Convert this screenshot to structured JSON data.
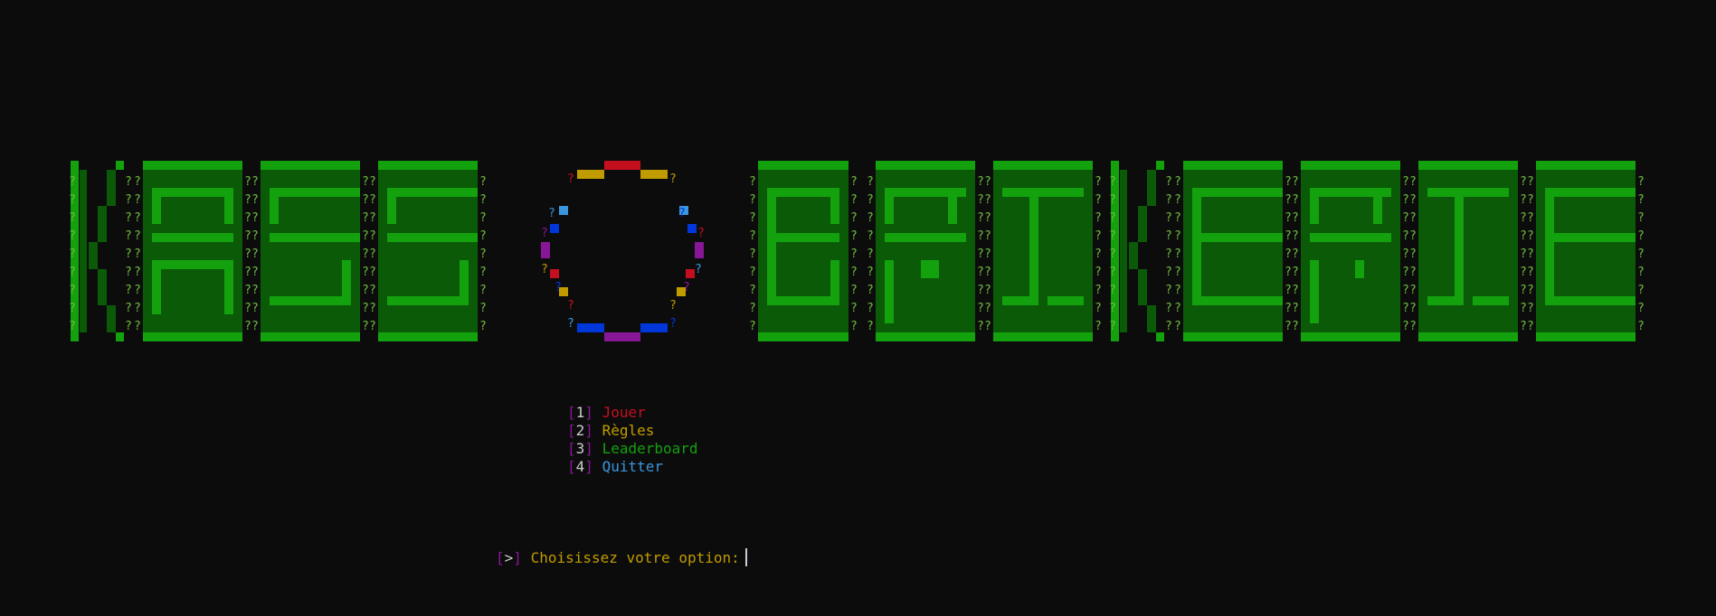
{
  "title_art": {
    "words": [
      "KASS",
      "BRIKERIE"
    ],
    "fill_char": "?",
    "colors": {
      "bright": "#13a10e",
      "dark": "#0b5a08",
      "shade": "#16c60c",
      "q": "#6fbf3f"
    }
  },
  "ring": {
    "segments": [
      {
        "color": "#c50f1f"
      },
      {
        "color": "#c19c00"
      },
      {
        "color": "#3a96dd"
      },
      {
        "color": "#0037da"
      },
      {
        "color": "#881798"
      }
    ]
  },
  "menu": {
    "items": [
      {
        "open": "[",
        "key": "1",
        "close": "]",
        "label": "Jouer",
        "color": "#c50f1f"
      },
      {
        "open": "[",
        "key": "2",
        "close": "]",
        "label": "Règles",
        "color": "#c19c00"
      },
      {
        "open": "[",
        "key": "3",
        "close": "]",
        "label": "Leaderboard",
        "color": "#13a10e"
      },
      {
        "open": "[",
        "key": "4",
        "close": "]",
        "label": "Quitter",
        "color": "#3a96dd"
      }
    ]
  },
  "prompt": {
    "open": "[",
    "arrow": ">",
    "close": "]",
    "text": "Choisissez votre option:"
  }
}
